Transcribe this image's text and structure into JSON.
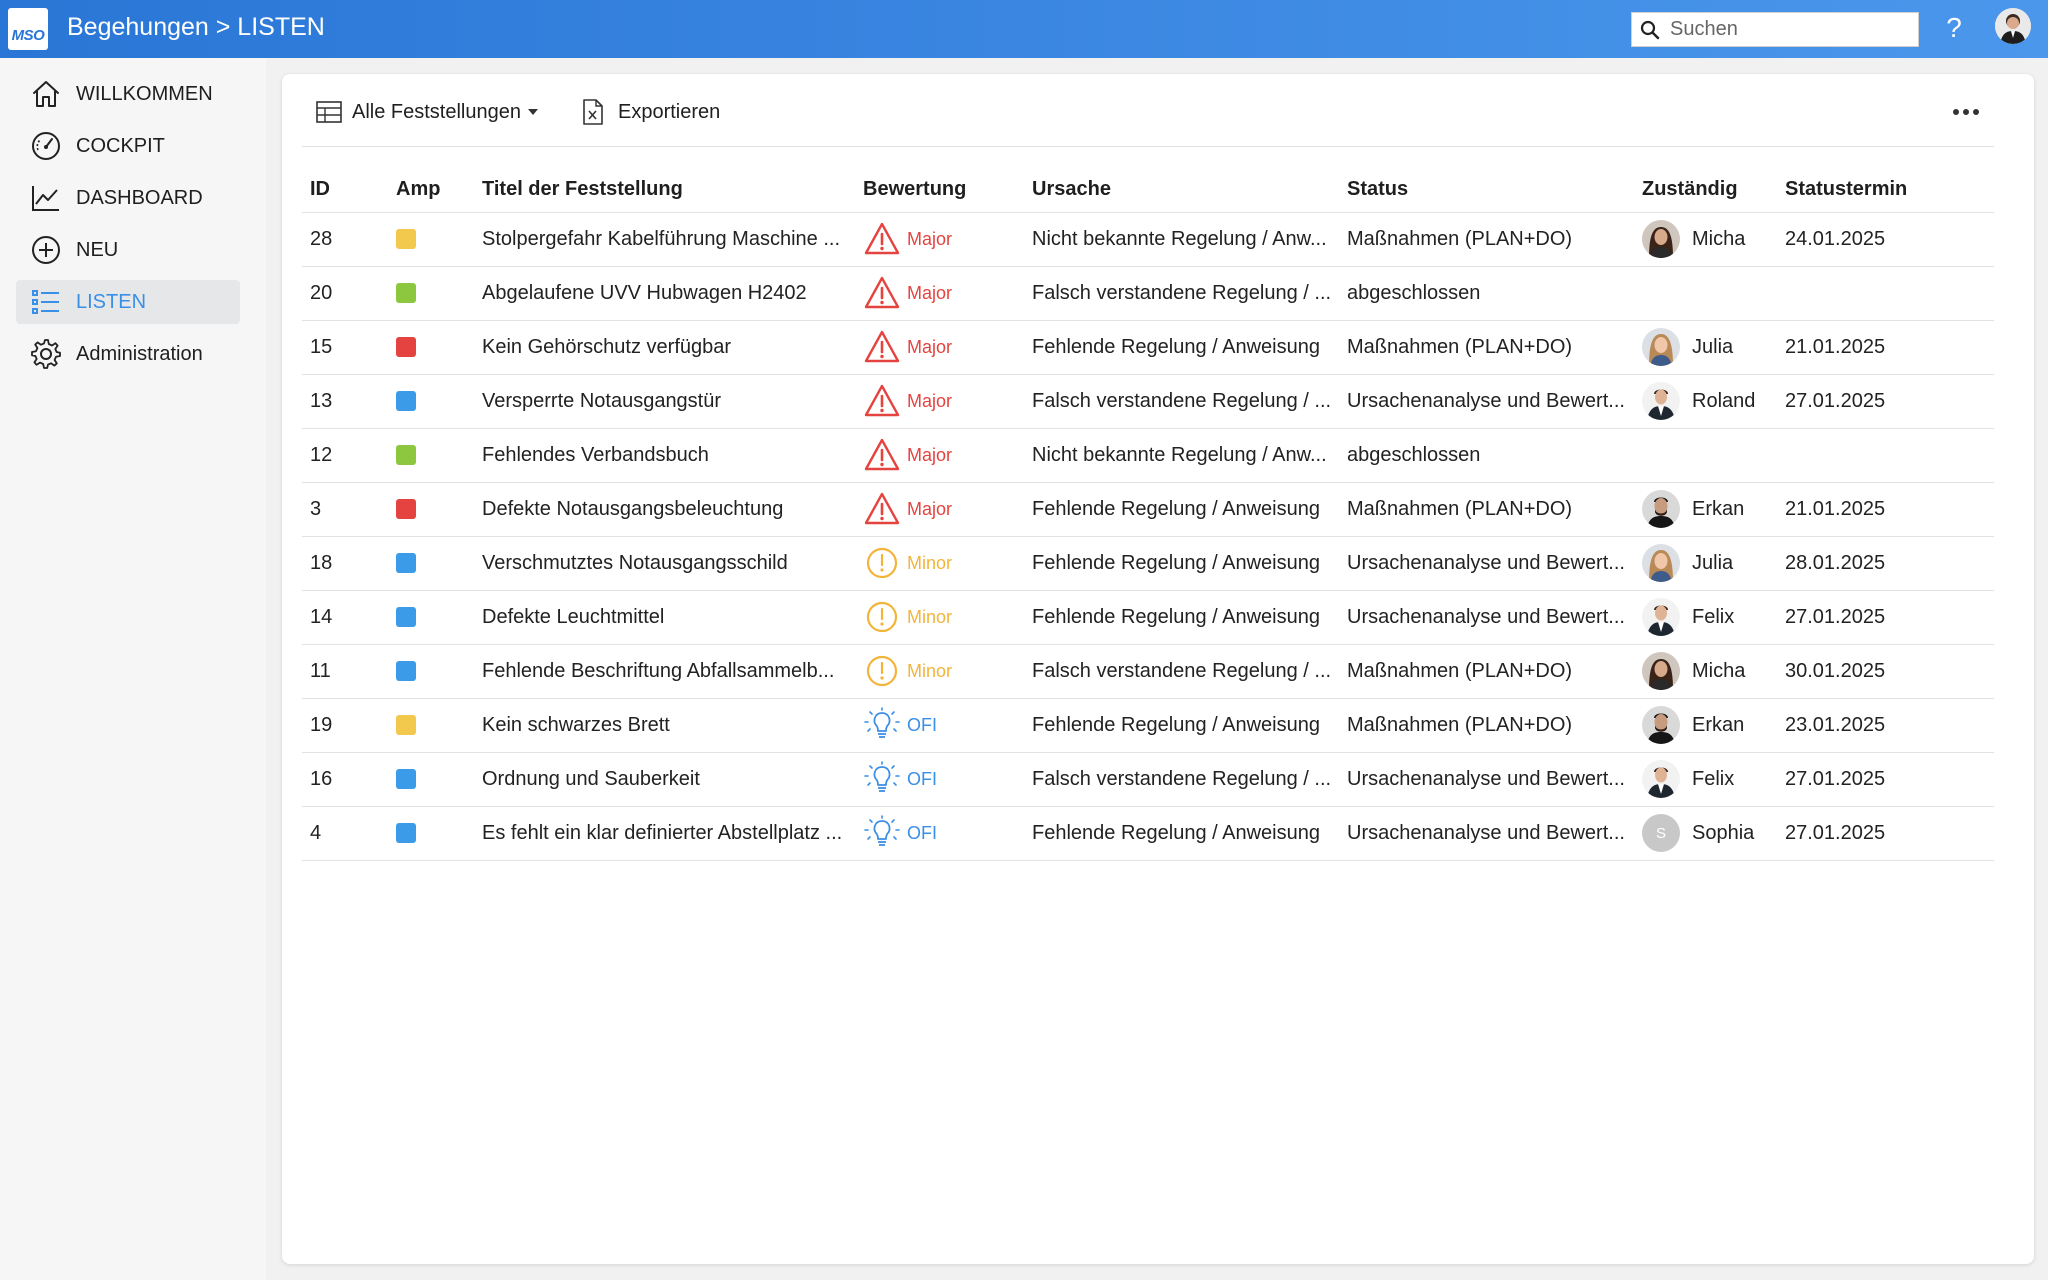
{
  "app": {
    "logo_text": "MSO",
    "title": "Begehungen > LISTEN",
    "search_placeholder": "Suchen",
    "help_label": "?"
  },
  "sidebar": {
    "items": [
      {
        "label": "WILLKOMMEN",
        "icon": "home-icon",
        "active": false
      },
      {
        "label": "COCKPIT",
        "icon": "gauge-icon",
        "active": false
      },
      {
        "label": "DASHBOARD",
        "icon": "chart-line-icon",
        "active": false
      },
      {
        "label": "NEU",
        "icon": "plus-circle-icon",
        "active": false
      },
      {
        "label": "LISTEN",
        "icon": "list-icon",
        "active": true
      },
      {
        "label": "Administration",
        "icon": "gear-icon",
        "active": false
      }
    ]
  },
  "toolbar": {
    "view_label": "Alle Feststellungen",
    "export_label": "Exportieren"
  },
  "colors": {
    "accent": "#3a8fe6",
    "amp_yellow": "#f2c94c",
    "amp_green": "#8dc63f",
    "amp_red": "#e5433f",
    "amp_blue": "#3b9be8",
    "major": "#e5433f",
    "minor": "#f3b43a",
    "ofi": "#3a8fe6"
  },
  "table": {
    "columns": [
      "ID",
      "Amp",
      "Titel der Feststellung",
      "Bewertung",
      "Ursache",
      "Status",
      "Zuständig",
      "Statustermin"
    ],
    "rows": [
      {
        "id": "28",
        "amp": "yellow",
        "title": "Stolpergefahr Kabelführung Maschine ...",
        "rating": "Major",
        "cause": "Nicht bekannte Regelung / Anw...",
        "status": "Maßnahmen (PLAN+DO)",
        "owner": "Micha",
        "avatar": "female-dark",
        "date": "24.01.2025"
      },
      {
        "id": "20",
        "amp": "green",
        "title": "Abgelaufene UVV Hubwagen H2402",
        "rating": "Major",
        "cause": "Falsch verstandene Regelung / ...",
        "status": "abgeschlossen",
        "owner": "",
        "avatar": "",
        "date": ""
      },
      {
        "id": "15",
        "amp": "red",
        "title": "Kein Gehörschutz verfügbar",
        "rating": "Major",
        "cause": "Fehlende Regelung / Anweisung",
        "status": "Maßnahmen (PLAN+DO)",
        "owner": "Julia",
        "avatar": "female-blonde",
        "date": "21.01.2025"
      },
      {
        "id": "13",
        "amp": "blue",
        "title": "Versperrte Notausgangstür",
        "rating": "Major",
        "cause": "Falsch verstandene Regelung / ...",
        "status": "Ursachenanalyse und Bewert...",
        "owner": "Roland",
        "avatar": "male-suit",
        "date": "27.01.2025"
      },
      {
        "id": "12",
        "amp": "green",
        "title": "Fehlendes Verbandsbuch",
        "rating": "Major",
        "cause": "Nicht bekannte Regelung / Anw...",
        "status": "abgeschlossen",
        "owner": "",
        "avatar": "",
        "date": ""
      },
      {
        "id": "3",
        "amp": "red",
        "title": "Defekte Notausgangsbeleuchtung",
        "rating": "Major",
        "cause": "Fehlende Regelung / Anweisung",
        "status": "Maßnahmen (PLAN+DO)",
        "owner": "Erkan",
        "avatar": "male-dark",
        "date": "21.01.2025"
      },
      {
        "id": "18",
        "amp": "blue",
        "title": "Verschmutztes Notausgangsschild",
        "rating": "Minor",
        "cause": "Fehlende Regelung / Anweisung",
        "status": "Ursachenanalyse und Bewert...",
        "owner": "Julia",
        "avatar": "female-blonde",
        "date": "28.01.2025"
      },
      {
        "id": "14",
        "amp": "blue",
        "title": "Defekte Leuchtmittel",
        "rating": "Minor",
        "cause": "Fehlende Regelung / Anweisung",
        "status": "Ursachenanalyse und Bewert...",
        "owner": "Felix",
        "avatar": "male-suit",
        "date": "27.01.2025"
      },
      {
        "id": "11",
        "amp": "blue",
        "title": "Fehlende Beschriftung Abfallsammelb...",
        "rating": "Minor",
        "cause": "Falsch verstandene Regelung / ...",
        "status": "Maßnahmen (PLAN+DO)",
        "owner": "Micha",
        "avatar": "female-dark",
        "date": "30.01.2025"
      },
      {
        "id": "19",
        "amp": "yellow",
        "title": "Kein schwarzes Brett",
        "rating": "OFI",
        "cause": "Fehlende Regelung / Anweisung",
        "status": "Maßnahmen (PLAN+DO)",
        "owner": "Erkan",
        "avatar": "male-dark",
        "date": "23.01.2025"
      },
      {
        "id": "16",
        "amp": "blue",
        "title": "Ordnung und Sauberkeit",
        "rating": "OFI",
        "cause": "Falsch verstandene Regelung / ...",
        "status": "Ursachenanalyse und Bewert...",
        "owner": "Felix",
        "avatar": "male-suit",
        "date": "27.01.2025"
      },
      {
        "id": "4",
        "amp": "blue",
        "title": "Es fehlt ein klar definierter Abstellplatz ...",
        "rating": "OFI",
        "cause": "Fehlende Regelung / Anweisung",
        "status": "Ursachenanalyse und Bewert...",
        "owner": "Sophia",
        "avatar": "initial",
        "initial": "S",
        "date": "27.01.2025"
      }
    ]
  }
}
